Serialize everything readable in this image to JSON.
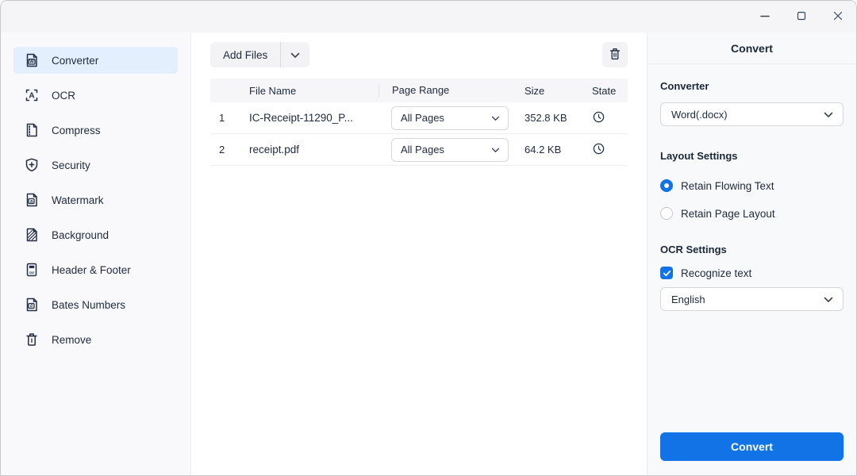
{
  "window": {
    "controls": [
      {
        "name": "minimize"
      },
      {
        "name": "maximize"
      },
      {
        "name": "close"
      }
    ]
  },
  "sidebar": {
    "items": [
      {
        "label": "Converter",
        "icon": "word-document-icon",
        "selected": true
      },
      {
        "label": "OCR",
        "icon": "ocr-text-icon",
        "selected": false
      },
      {
        "label": "Compress",
        "icon": "compress-zip-icon",
        "selected": false
      },
      {
        "label": "Security",
        "icon": "shield-plus-icon",
        "selected": false
      },
      {
        "label": "Watermark",
        "icon": "watermark-doc-icon",
        "selected": false
      },
      {
        "label": "Background",
        "icon": "background-doc-icon",
        "selected": false
      },
      {
        "label": "Header & Footer",
        "icon": "header-footer-doc-icon",
        "selected": false
      },
      {
        "label": "Bates Numbers",
        "icon": "bates-number-doc-icon",
        "selected": false
      },
      {
        "label": "Remove",
        "icon": "trash-icon",
        "selected": false
      }
    ]
  },
  "toolbar": {
    "add_files_label": "Add Files",
    "add_files_dropdown_icon": "chevron-down-icon",
    "delete_icon": "trash-icon"
  },
  "table": {
    "headers": {
      "file_name": "File Name",
      "page_range": "Page Range",
      "size": "Size",
      "state": "State"
    },
    "rows": [
      {
        "index": "1",
        "file_name": "IC-Receipt-11290_P...",
        "page_range": "All Pages",
        "size": "352.8 KB",
        "state_icon": "clock-pending-icon"
      },
      {
        "index": "2",
        "file_name": "receipt.pdf",
        "page_range": "All Pages",
        "size": "64.2 KB",
        "state_icon": "clock-pending-icon"
      }
    ]
  },
  "panel": {
    "title": "Convert",
    "converter_label": "Converter",
    "converter_value": "Word(.docx)",
    "layout_settings_label": "Layout Settings",
    "radio_options": [
      {
        "label": "Retain Flowing Text",
        "selected": true
      },
      {
        "label": "Retain Page Layout",
        "selected": false
      }
    ],
    "ocr_settings_label": "OCR Settings",
    "recognize_text_label": "Recognize text",
    "recognize_text_checked": true,
    "language_value": "English",
    "convert_button_label": "Convert"
  },
  "colors": {
    "accent": "#1173E6",
    "selected_item_bg": "#E4EFFE",
    "titlebar_bg": "#F5F5F7",
    "panel_bg": "#F8F9FA"
  }
}
